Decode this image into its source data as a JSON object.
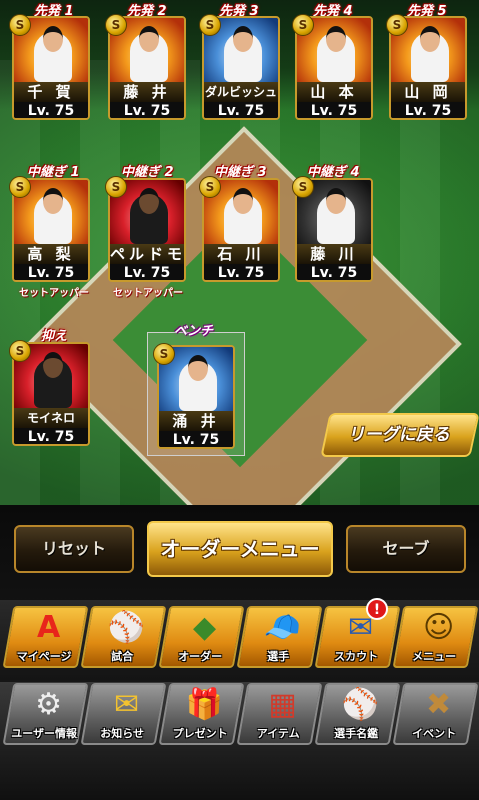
{
  "rotation": [
    {
      "role": "先発 1",
      "name": "千 賀",
      "level": "Lv. 75",
      "rank": "S",
      "art": "orange"
    },
    {
      "role": "先発 2",
      "name": "藤 井",
      "level": "Lv. 75",
      "rank": "S",
      "art": "orange"
    },
    {
      "role": "先発 3",
      "name": "ダルビッシュ",
      "level": "Lv. 75",
      "rank": "S",
      "art": "blue"
    },
    {
      "role": "先発 4",
      "name": "山 本",
      "level": "Lv. 75",
      "rank": "S",
      "art": "orange"
    },
    {
      "role": "先発 5",
      "name": "山 岡",
      "level": "Lv. 75",
      "rank": "S",
      "art": "orange"
    }
  ],
  "relievers": [
    {
      "role": "中継ぎ 1",
      "name": "高 梨",
      "level": "Lv. 75",
      "rank": "S",
      "sub": "セットアッパー",
      "art": "orange"
    },
    {
      "role": "中継ぎ 2",
      "name": "ペルドモ",
      "level": "Lv. 75",
      "rank": "S",
      "sub": "セットアッパー",
      "art": "red"
    },
    {
      "role": "中継ぎ 3",
      "name": "石 川",
      "level": "Lv. 75",
      "rank": "S",
      "sub": "",
      "art": "orange"
    },
    {
      "role": "中継ぎ 4",
      "name": "藤 川",
      "level": "Lv. 75",
      "rank": "S",
      "sub": "",
      "art": "dark"
    }
  ],
  "closer": {
    "role": "抑え",
    "name": "モイネロ",
    "level": "Lv. 75",
    "rank": "S",
    "art": "red"
  },
  "bench": {
    "role": "ベンチ",
    "name": "涌 井",
    "level": "Lv. 75",
    "rank": "S",
    "art": "orange"
  },
  "actions": {
    "back_to_league": "リーグに戻る",
    "reset": "リセット",
    "order_menu": "オーダーメニュー",
    "save": "セーブ"
  },
  "main_menu": [
    {
      "label": "マイページ",
      "icon": "A"
    },
    {
      "label": "試合",
      "icon": "⚾"
    },
    {
      "label": "オーダー",
      "icon": "◆"
    },
    {
      "label": "選手",
      "icon": "🧢"
    },
    {
      "label": "スカウト",
      "icon": "✉"
    },
    {
      "label": "メニュー",
      "icon": "☺"
    }
  ],
  "scout_badge": "!",
  "sub_menu": [
    {
      "label": "ユーザー情報",
      "icon": "⚙"
    },
    {
      "label": "お知らせ",
      "icon": "✉"
    },
    {
      "label": "プレゼント",
      "icon": "🎁"
    },
    {
      "label": "アイテム",
      "icon": "▦"
    },
    {
      "label": "選手名鑑",
      "icon": "⚾"
    },
    {
      "label": "イベント",
      "icon": "✖"
    }
  ],
  "colors": {
    "accent_gold": "#d9a21d",
    "role_red": "#cc0000",
    "bench_purple": "#aa00aa",
    "badge_red": "#e01818"
  }
}
